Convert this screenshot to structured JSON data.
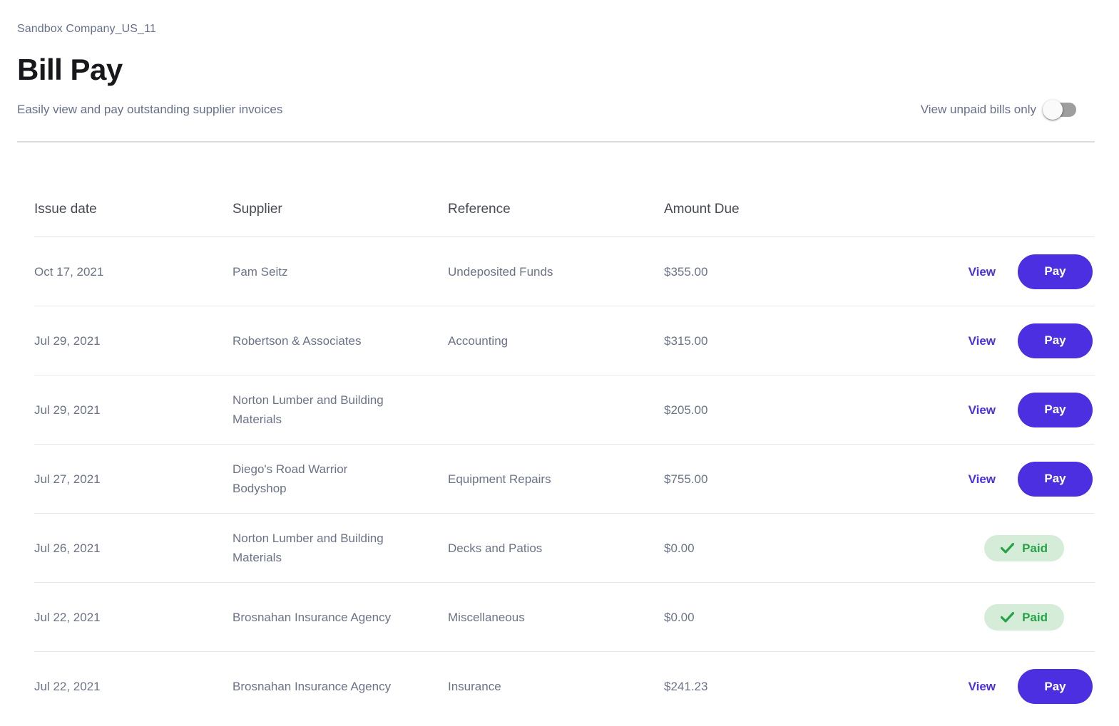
{
  "page": {
    "company": "Sandbox Company_US_11",
    "title": "Bill Pay",
    "subtitle": "Easily view and pay outstanding supplier invoices",
    "toggle": {
      "label": "View unpaid bills only",
      "state": "off"
    }
  },
  "table": {
    "columns": [
      "Issue date",
      "Supplier",
      "Reference",
      "Amount Due"
    ],
    "view_label": "View",
    "pay_label": "Pay",
    "paid_label": "Paid",
    "rows": [
      {
        "issue_date": "Oct 17, 2021",
        "supplier": "Pam Seitz",
        "reference": "Undeposited Funds",
        "amount_due": "$355.00",
        "status": "unpaid"
      },
      {
        "issue_date": "Jul 29, 2021",
        "supplier": "Robertson & Associates",
        "reference": "Accounting",
        "amount_due": "$315.00",
        "status": "unpaid"
      },
      {
        "issue_date": "Jul 29, 2021",
        "supplier": "Norton Lumber and Building Materials",
        "reference": "",
        "amount_due": "$205.00",
        "status": "unpaid"
      },
      {
        "issue_date": "Jul 27, 2021",
        "supplier": "Diego's Road Warrior Bodyshop",
        "reference": "Equipment Repairs",
        "amount_due": "$755.00",
        "status": "unpaid"
      },
      {
        "issue_date": "Jul 26, 2021",
        "supplier": "Norton Lumber and Building Materials",
        "reference": "Decks and Patios",
        "amount_due": "$0.00",
        "status": "paid"
      },
      {
        "issue_date": "Jul 22, 2021",
        "supplier": "Brosnahan Insurance Agency",
        "reference": "Miscellaneous",
        "amount_due": "$0.00",
        "status": "paid"
      },
      {
        "issue_date": "Jul 22, 2021",
        "supplier": "Brosnahan Insurance Agency",
        "reference": "Insurance",
        "amount_due": "$241.23",
        "status": "unpaid"
      }
    ]
  },
  "colors": {
    "accent_purple": "#4B2FE0",
    "paid_green": "#27A346",
    "paid_badge_bg": "#D5ECD9",
    "body_text": "#6B7387",
    "header_text": "#474A54",
    "title_text": "#17171C",
    "divider": "#E3E3E3",
    "toggle_track_off": "#9E9E9E"
  }
}
